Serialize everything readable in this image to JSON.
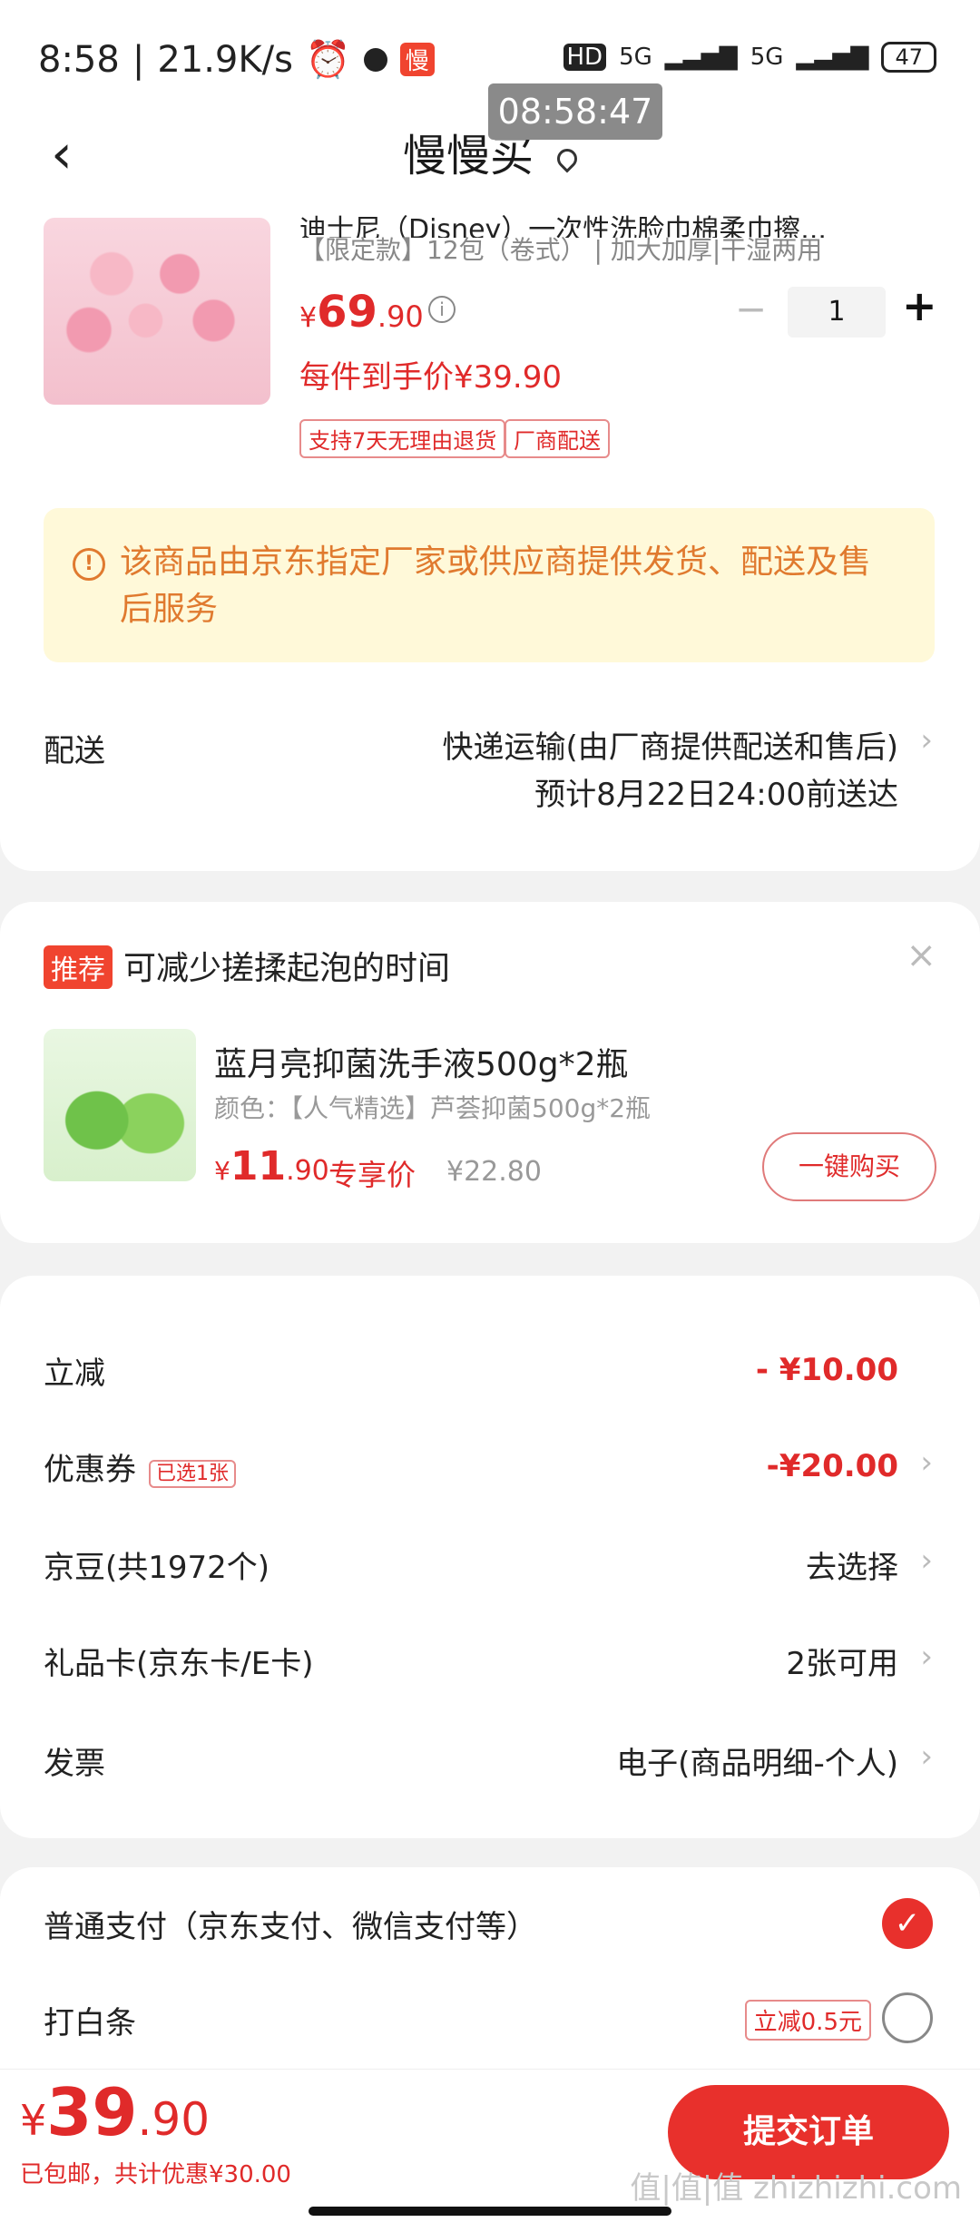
{
  "status": {
    "time": "8:58",
    "speed": "21.9K/s",
    "app": "慢",
    "net1": "5G",
    "net2": "5G",
    "battery": "47",
    "hd": "HD"
  },
  "overlay_time": "08:58:47",
  "nav": {
    "title": "慢慢买"
  },
  "product": {
    "title_partial": "迪士尼（Disney）一次性洗脸巾棉柔巾擦...",
    "spec": "【限定款】12包（卷式） | 加大加厚|干湿两用",
    "price_yen": "¥",
    "price_int": "69",
    "price_dec": ".90",
    "quantity": "1",
    "per_price": "每件到手价¥39.90",
    "tags": [
      "支持7天无理由退货",
      "厂商配送"
    ]
  },
  "notice": {
    "text": "该商品由京东指定厂家或供应商提供发货、配送及售后服务"
  },
  "shipping": {
    "label": "配送",
    "method": "快递运输(由厂商提供配送和售后)",
    "eta": "预计8月22日24:00前送达"
  },
  "recommend": {
    "badge": "推荐",
    "title": "可减少搓揉起泡的时间",
    "name": "蓝月亮抑菌洗手液500g*2瓶",
    "spec": "颜色：【人气精选】芦荟抑菌500g*2瓶",
    "price_yen": "¥",
    "price_int": "11",
    "price_dec": ".90",
    "exclusive": "专享价",
    "orig_price": "¥22.80",
    "buy_label": "一键购买",
    "close": "×"
  },
  "summary": [
    {
      "label": "立减",
      "value": "- ¥10.00"
    },
    {
      "label": "优惠券",
      "tag": "已选1张",
      "value": "-¥20.00"
    },
    {
      "label": "京豆(共1972个)",
      "value": "去选择"
    },
    {
      "label": "礼品卡(京东卡/E卡)",
      "value": "2张可用"
    },
    {
      "label": "发票",
      "value": "电子(商品明细-个人)"
    }
  ],
  "payment": {
    "normal": "普通支付（京东支付、微信支付等）",
    "baitiao": "打白条",
    "baitiao_tag": "立减0.5元"
  },
  "bottom": {
    "yen": "¥",
    "int": "39",
    "dec": ".90",
    "note": "已包邮，共计优惠¥30.00",
    "submit": "提交订单"
  },
  "watermark": "值|值|值 zhizhizhi.com",
  "colors": {
    "accent": "#e8302c",
    "notice_bg": "#fff9d9",
    "notice_text": "#e07a2f"
  }
}
